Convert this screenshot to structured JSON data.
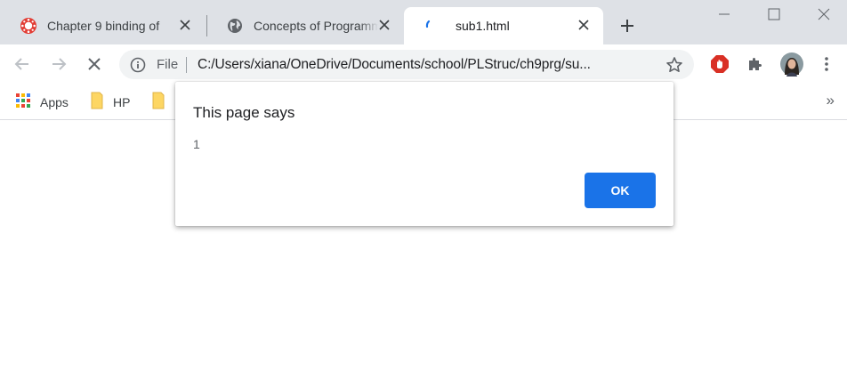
{
  "tabs": [
    {
      "title": "Chapter 9 binding of ",
      "icon": "canvas-logo-icon"
    },
    {
      "title": "Concepts of Programm",
      "icon": "globe-icon"
    },
    {
      "title": "sub1.html",
      "icon": "loading-spinner-icon",
      "active": true
    }
  ],
  "new_tab_icon": "plus-icon",
  "window_controls": [
    "minimize-icon",
    "maximize-icon",
    "close-icon"
  ],
  "toolbar": {
    "back_icon": "arrow-left-icon",
    "forward_icon": "arrow-right-icon",
    "stop_icon": "stop-loading-icon",
    "omnibox": {
      "scheme_label": "File",
      "url": "C:/Users/xiana/OneDrive/Documents/school/PLStruc/ch9prg/su..."
    },
    "extensions": [
      "adblock-icon",
      "puzzle-extensions-icon",
      "profile-avatar",
      "kebab-menu-icon"
    ]
  },
  "bookmarks": [
    {
      "label": "Apps",
      "icon": "apps-grid-icon"
    },
    {
      "label": "HP",
      "icon": "folder-icon"
    },
    {
      "label": "",
      "icon": "folder-icon"
    }
  ],
  "bookmarks_overflow": "»",
  "dialog": {
    "title": "This page says",
    "message": "1",
    "ok_label": "OK"
  },
  "colors": {
    "tabstrip_bg": "#dee1e6",
    "accent_blue": "#1a73e8",
    "omnibox_bg": "#f1f3f4",
    "adblock_red": "#d93025"
  }
}
